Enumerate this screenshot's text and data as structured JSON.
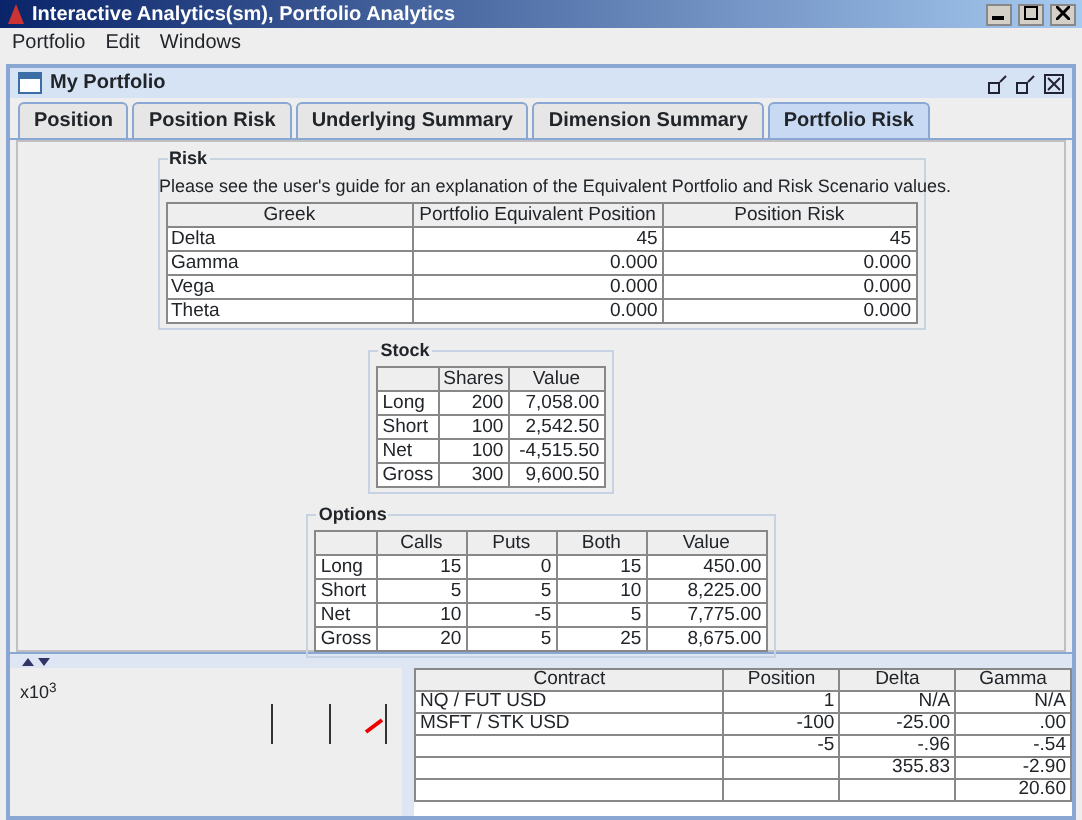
{
  "window": {
    "title": "Interactive Analytics(sm), Portfolio Analytics"
  },
  "menu": [
    "Portfolio",
    "Edit",
    "Windows"
  ],
  "frame": {
    "title": "My Portfolio"
  },
  "tabs": [
    {
      "label": "Position",
      "selected": false
    },
    {
      "label": "Position Risk",
      "selected": false
    },
    {
      "label": "Underlying Summary",
      "selected": false
    },
    {
      "label": "Dimension Summary",
      "selected": false
    },
    {
      "label": "Portfolio Risk",
      "selected": true
    }
  ],
  "risk": {
    "title": "Risk",
    "note": "Please see the user's guide for an explanation of the Equivalent Portfolio and Risk Scenario values.",
    "columns": [
      "Greek",
      "Portfolio Equivalent Position",
      "Position Risk"
    ],
    "rows": [
      [
        "Delta",
        "45",
        "45"
      ],
      [
        "Gamma",
        "0.000",
        "0.000"
      ],
      [
        "Vega",
        "0.000",
        "0.000"
      ],
      [
        "Theta",
        "0.000",
        "0.000"
      ]
    ]
  },
  "stock": {
    "title": "Stock",
    "columns": [
      "",
      "Shares",
      "Value"
    ],
    "rows": [
      [
        "Long",
        "200",
        "7,058.00"
      ],
      [
        "Short",
        "100",
        "2,542.50"
      ],
      [
        "Net",
        "100",
        "-4,515.50"
      ],
      [
        "Gross",
        "300",
        "9,600.50"
      ]
    ]
  },
  "options": {
    "title": "Options",
    "columns": [
      "",
      "Calls",
      "Puts",
      "Both",
      "Value"
    ],
    "rows": [
      [
        "Long",
        "15",
        "0",
        "15",
        "450.00"
      ],
      [
        "Short",
        "5",
        "5",
        "10",
        "8,225.00"
      ],
      [
        "Net",
        "10",
        "-5",
        "5",
        "7,775.00"
      ],
      [
        "Gross",
        "20",
        "5",
        "25",
        "8,675.00"
      ]
    ]
  },
  "bottom": {
    "chart_label": "x10$^{3}$",
    "columns": [
      "Contract",
      "Position",
      "Delta",
      "Gamma"
    ],
    "rows": [
      [
        "NQ / FUT USD",
        "1",
        "N/A",
        "N/A"
      ],
      [
        "MSFT / STK USD",
        "-100",
        "-25.00",
        ".00"
      ],
      [
        "",
        "-5",
        "-.96",
        "-.54"
      ],
      [
        "",
        "",
        "355.83",
        "-2.90"
      ],
      [
        "",
        "",
        "",
        "20.60"
      ]
    ]
  }
}
